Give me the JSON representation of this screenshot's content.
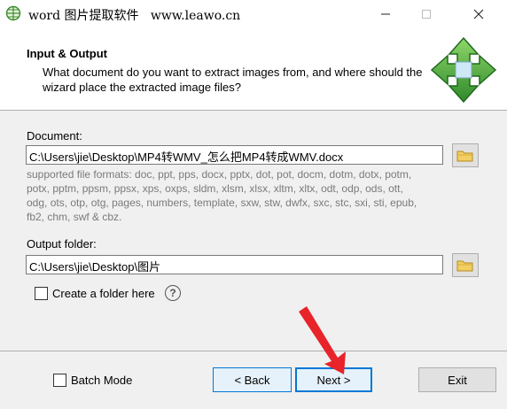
{
  "window": {
    "title": "word 图片提取软件   www.leawo.cn",
    "app_icon": "globe-grid-icon",
    "controls": {
      "minimize": "─",
      "maximize": "☐",
      "close": "✕"
    }
  },
  "header": {
    "title": "Input & Output",
    "description": "What document do you want to extract images from, and where should the wizard place the extracted image files?",
    "icon": "four-way-arrow-icon",
    "accent_green": "#3a9a3a"
  },
  "document": {
    "label": "Document:",
    "value": "C:\\Users\\jie\\Desktop\\MP4转WMV_怎么把MP4转成WMV.docx",
    "supported_formats": "supported file formats: doc, ppt, pps, docx, pptx, dot, pot, docm, dotm, dotx, potm, potx, pptm, ppsm, ppsx, xps, oxps, sldm, xlsm, xlsx, xltm, xltx, odt, odp, ods, ott, odg, ots, otp, otg, pages, numbers, template, sxw, stw, dwfx, sxc, stc, sxi, sti, epub, fb2, chm, swf & cbz."
  },
  "output": {
    "label": "Output folder:",
    "value": "C:\\Users\\jie\\Desktop\\图片",
    "create_folder_label": "Create a folder here",
    "create_folder_checked": false,
    "help_glyph": "?"
  },
  "footer": {
    "batch_mode_label": "Batch Mode",
    "batch_mode_checked": false,
    "back_label": "< Back",
    "next_label": "Next >",
    "exit_label": "Exit"
  },
  "annotation": {
    "arrow_color": "#e8232a"
  }
}
